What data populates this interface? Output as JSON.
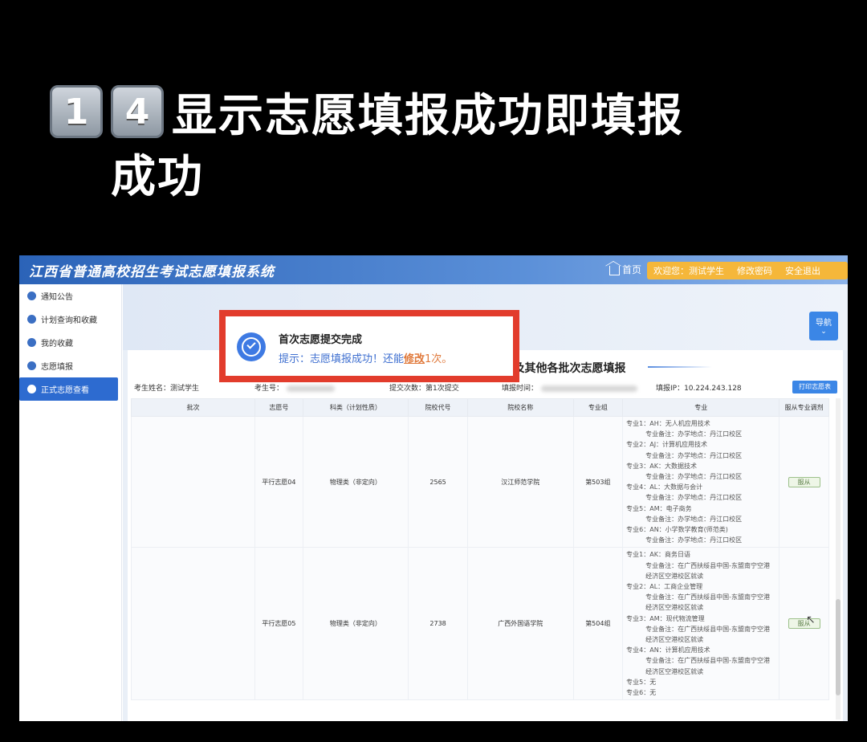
{
  "caption": {
    "keycaps": [
      "1",
      "4"
    ],
    "line1": "显示志愿填报成功即填报",
    "line2": "成功"
  },
  "header": {
    "system_title": "江西省普通高校招生考试志愿填报系统",
    "home": "首页",
    "welcome": "欢迎您：测试学生",
    "change_password": "修改密码",
    "logout": "安全退出"
  },
  "sidebar": {
    "items": [
      {
        "label": "通知公告"
      },
      {
        "label": "计划查询和收藏"
      },
      {
        "label": "我的收藏"
      },
      {
        "label": "志愿填报"
      },
      {
        "label": "正式志愿查看"
      }
    ]
  },
  "nav_button": "导航",
  "notice": {
    "title": "首次志愿提交完成",
    "msg_prefix": "提示：志愿填报成功！还能",
    "modify": "修改",
    "msg_suffix": "1次。"
  },
  "form": {
    "title": "江西省普通高考提前本科非军事类及其他各批次志愿填报",
    "student_name": "考生姓名：测试学生",
    "student_no": "考生号：",
    "submit_count": "提交次数：第1次提交",
    "fill_time": "填报时间：",
    "fill_ip": "填报IP：10.224.243.128",
    "print_button": "打印志愿表"
  },
  "table": {
    "headers": [
      "批次",
      "志愿号",
      "科类（计划性质）",
      "院校代号",
      "院校名称",
      "专业组",
      "专业",
      "服从专业调剂"
    ],
    "rows": [
      {
        "pref": "平行志愿04",
        "category": "物理类（非定向）",
        "code": "2565",
        "school": "汉江师范学院",
        "group": "第503组",
        "obey": "服从",
        "majors": [
          {
            "name": "专业1：AH：无人机应用技术",
            "note": "专业备注：办学地点：丹江口校区"
          },
          {
            "name": "专业2：AJ：计算机应用技术",
            "note": "专业备注：办学地点：丹江口校区"
          },
          {
            "name": "专业3：AK：大数据技术",
            "note": "专业备注：办学地点：丹江口校区"
          },
          {
            "name": "专业4：AL：大数据与会计",
            "note": "专业备注：办学地点：丹江口校区"
          },
          {
            "name": "专业5：AM：电子商务",
            "note": "专业备注：办学地点：丹江口校区"
          },
          {
            "name": "专业6：AN：小学数学教育(师范类)",
            "note": "专业备注：办学地点：丹江口校区"
          }
        ]
      },
      {
        "pref": "平行志愿05",
        "category": "物理类（非定向）",
        "code": "2738",
        "school": "广西外国语学院",
        "group": "第504组",
        "obey": "服从",
        "majors": [
          {
            "name": "专业1：AK：商务日语",
            "note": "专业备注：在广西扶绥县中国-东盟南宁空港经济区空港校区就读"
          },
          {
            "name": "专业2：AL：工商企业管理",
            "note": "专业备注：在广西扶绥县中国-东盟南宁空港经济区空港校区就读"
          },
          {
            "name": "专业3：AM：现代物流管理",
            "note": "专业备注：在广西扶绥县中国-东盟南宁空港经济区空港校区就读"
          },
          {
            "name": "专业4：AN：计算机应用技术",
            "note": "专业备注：在广西扶绥县中国-东盟南宁空港经济区空港校区就读"
          },
          {
            "name": "专业5：无",
            "note": ""
          },
          {
            "name": "专业6：无",
            "note": ""
          }
        ]
      }
    ]
  }
}
